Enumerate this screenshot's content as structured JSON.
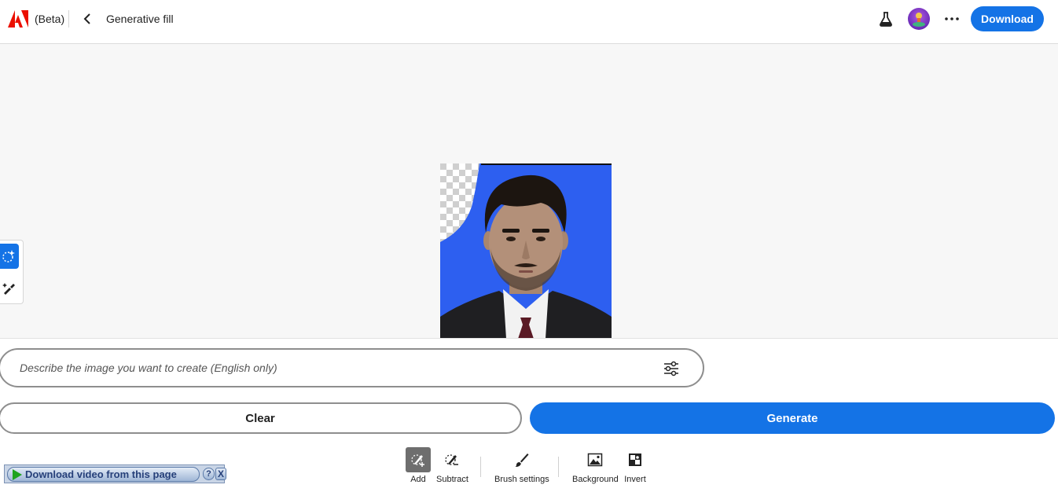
{
  "header": {
    "beta_label": "(Beta)",
    "title": "Generative fill",
    "download_label": "Download",
    "icons": [
      "adobe-logo",
      "chevron-left-icon",
      "flask-icon",
      "avatar",
      "more-icon"
    ]
  },
  "prompt": {
    "placeholder": "Describe the image you want to create (English only)",
    "value": ""
  },
  "actions": {
    "clear_label": "Clear",
    "generate_label": "Generate"
  },
  "bottom_toolbar": {
    "items": [
      {
        "label": "Add",
        "icon": "brush-add-icon",
        "active": true
      },
      {
        "label": "Subtract",
        "icon": "brush-subtract-icon",
        "active": false
      },
      {
        "label": "Brush settings",
        "icon": "brush-icon",
        "active": false
      },
      {
        "label": "Background",
        "icon": "image-icon",
        "active": false
      },
      {
        "label": "Invert",
        "icon": "invert-icon",
        "active": false
      }
    ]
  },
  "left_tools": [
    {
      "icon": "generative-fill-icon",
      "active": true
    },
    {
      "icon": "remove-brush-icon",
      "active": false
    }
  ],
  "extension": {
    "label": "Download video from this page",
    "help": "?",
    "close": "X"
  },
  "colors": {
    "accent": "#1473e6",
    "photo_background": "#2d5ff0"
  }
}
